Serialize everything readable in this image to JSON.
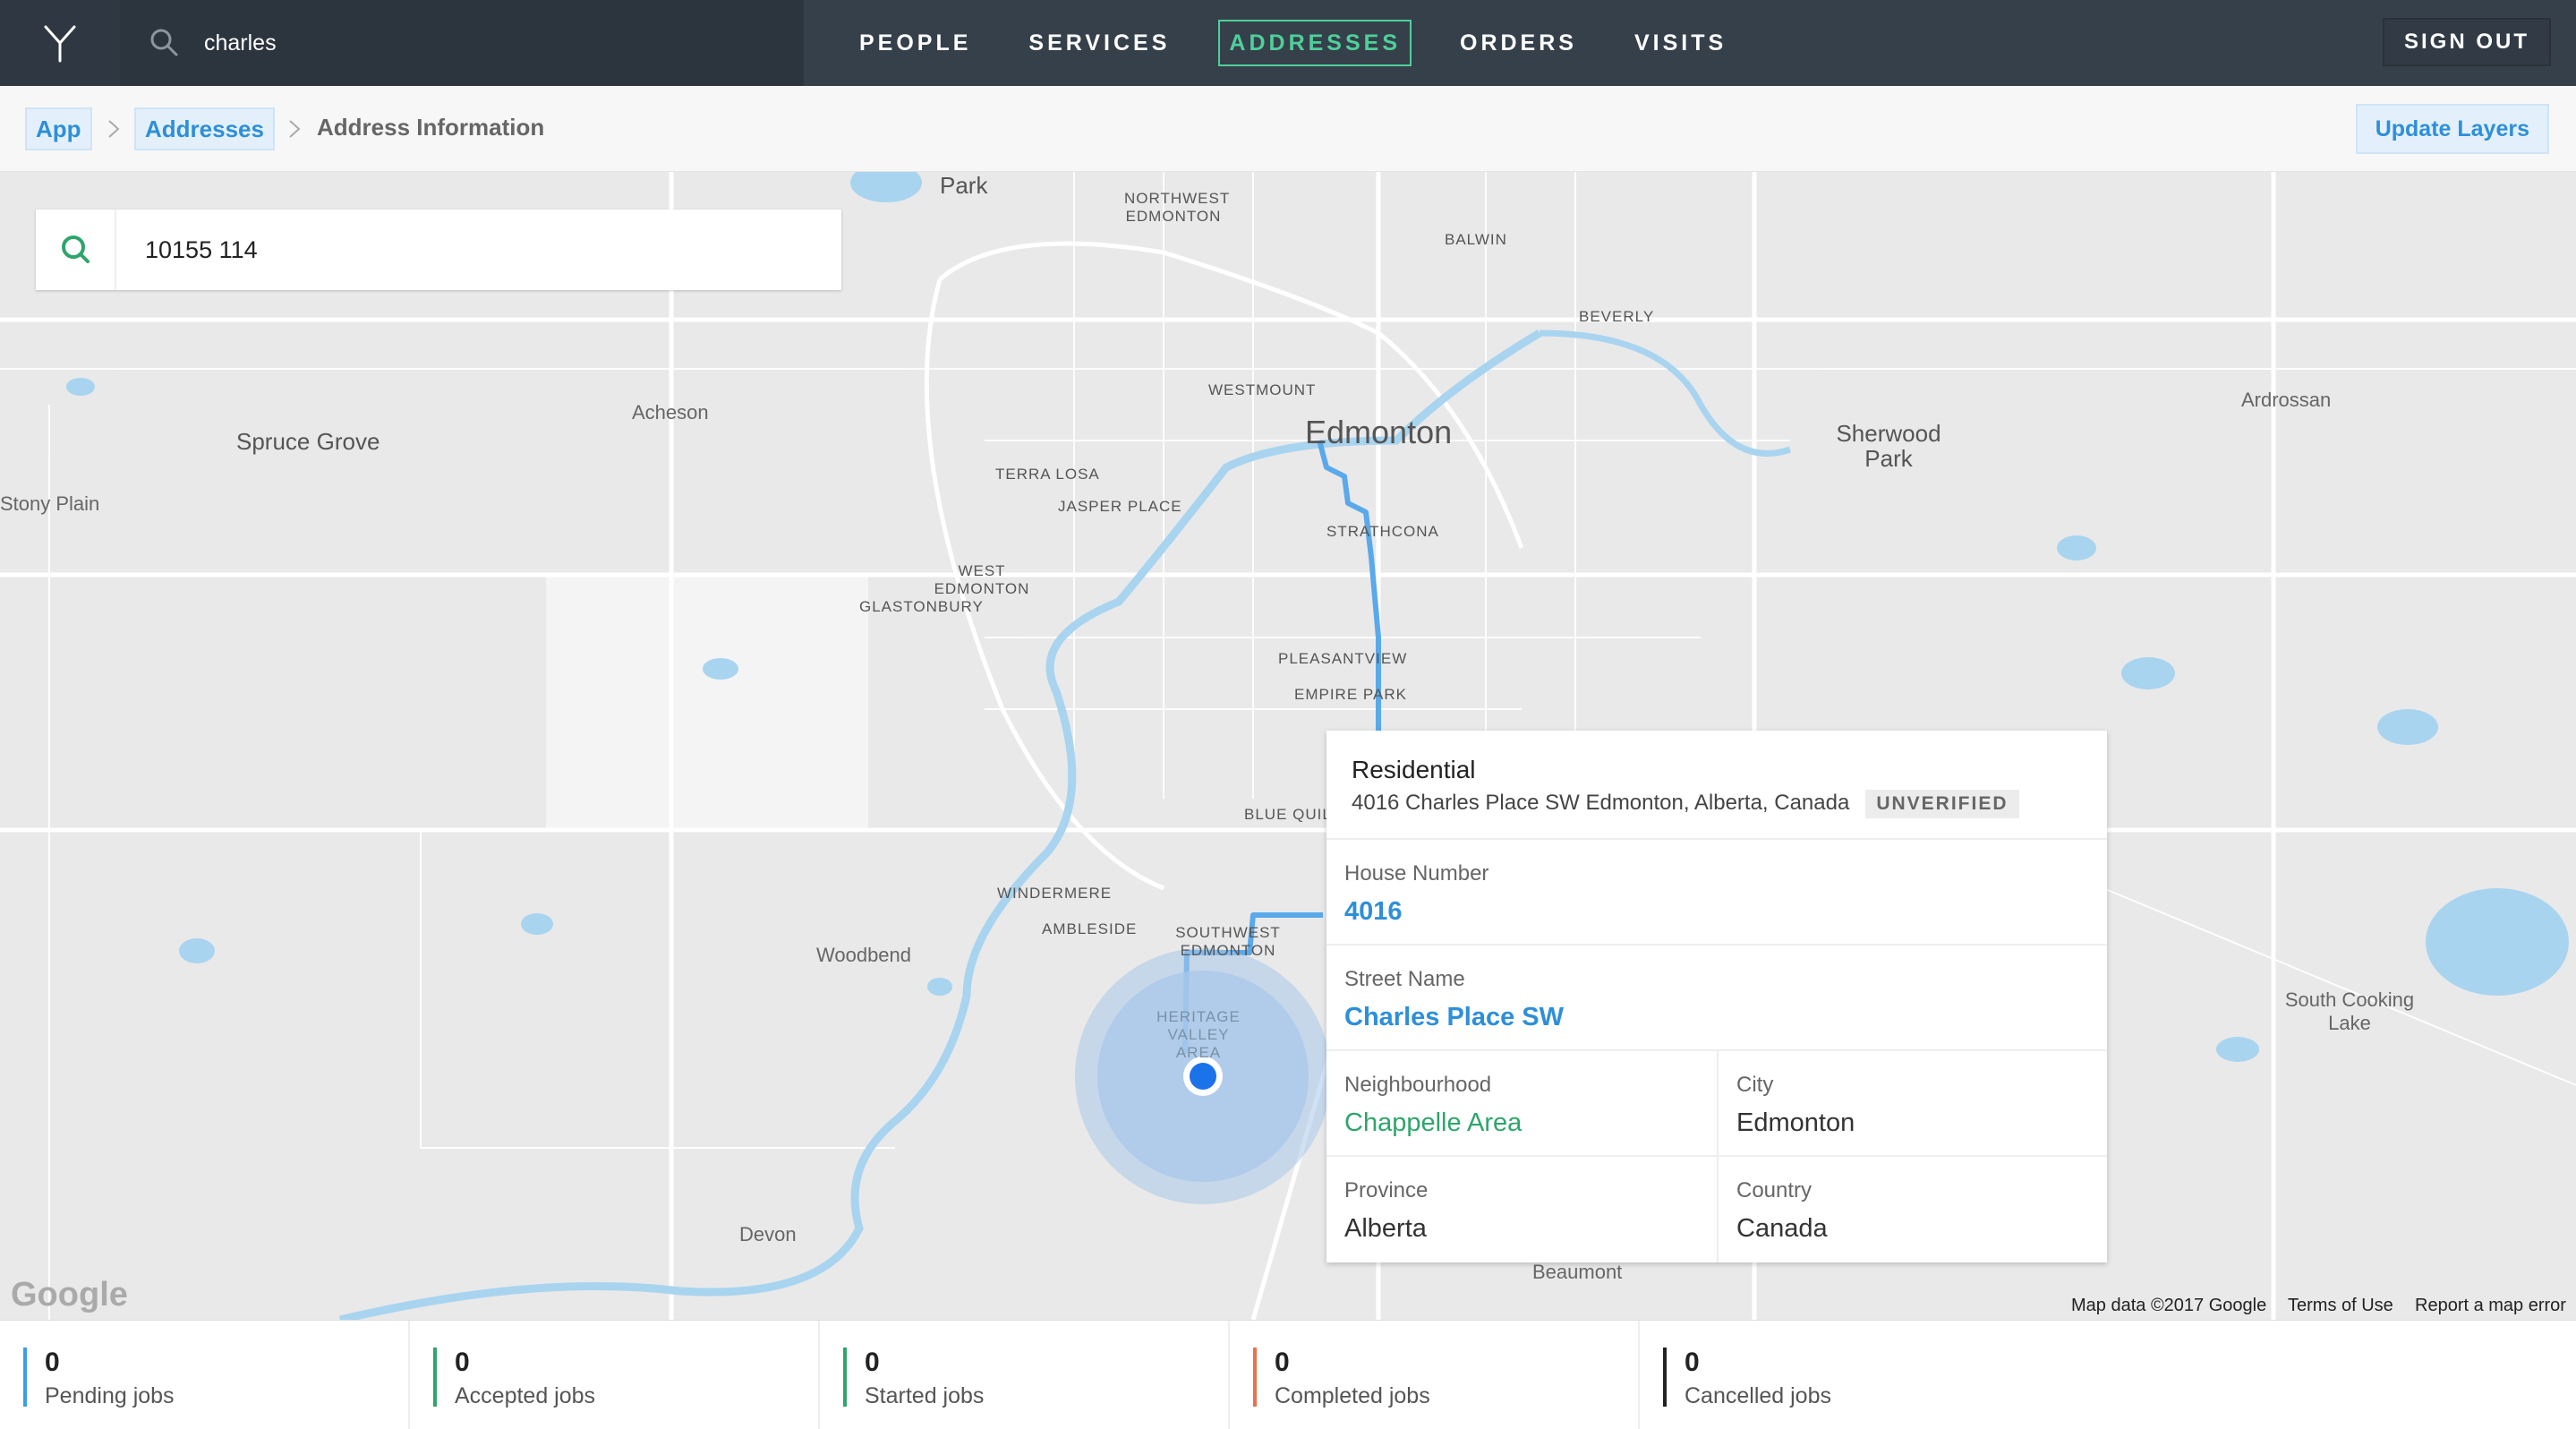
{
  "topbar": {
    "search_value": "charles",
    "nav": [
      "PEOPLE",
      "SERVICES",
      "ADDRESSES",
      "ORDERS",
      "VISITS"
    ],
    "active": "ADDRESSES",
    "sign_out": "SIGN OUT"
  },
  "breadcrumb": {
    "items": [
      "App",
      "Addresses",
      "Address Information"
    ],
    "update_button": "Update Layers"
  },
  "map": {
    "search_value": "10155 114",
    "labels": {
      "park": "Park",
      "northwest_edmonton": "NORTHWEST EDMONTON",
      "balwin": "BALWIN",
      "beverly": "BEVERLY",
      "westmount": "WESTMOUNT",
      "edmonton": "Edmonton",
      "sherwood_park": "Sherwood Park",
      "ardrossan": "Ardrossan",
      "spruce_grove": "Spruce Grove",
      "acheson": "Acheson",
      "stony_plain": "Stony Plain",
      "terra_losa": "TERRA LOSA",
      "jasper_place": "JASPER PLACE",
      "strathcona": "STRATHCONA",
      "west_edmonton": "WEST EDMONTON",
      "glastonbury": "GLASTONBURY",
      "pleasantview": "PLEASANTVIEW",
      "empire_park": "EMPIRE PARK",
      "blue_quill": "BLUE QUILL",
      "windermere": "WINDERMERE",
      "ambleside": "AMBLESIDE",
      "southwest_edmonton": "SOUTHWEST EDMONTON",
      "woodbend": "Woodbend",
      "heritage_valley": "HERITAGE VALLEY AREA",
      "devon": "Devon",
      "beaumont": "Beaumont",
      "south_cooking_lake": "South Cooking Lake"
    },
    "attribution": {
      "google": "Google",
      "map_data": "Map data ©2017 Google",
      "terms": "Terms of Use",
      "report": "Report a map error"
    },
    "colors": {
      "water": "#a8d4f0",
      "route": "#5aa9ea",
      "marker": "#1a73e8"
    }
  },
  "card": {
    "type": "Residential",
    "address": "4016 Charles Place SW Edmonton, Alberta, Canada",
    "badge": "UNVERIFIED",
    "house_number_label": "House Number",
    "house_number": "4016",
    "street_name_label": "Street Name",
    "street_name": "Charles Place SW",
    "neighbourhood_label": "Neighbourhood",
    "neighbourhood": "Chappelle Area",
    "city_label": "City",
    "city": "Edmonton",
    "province_label": "Province",
    "province": "Alberta",
    "country_label": "Country",
    "country": "Canada"
  },
  "stats": [
    {
      "count": "0",
      "label": "Pending jobs",
      "color": "#3a9ee6"
    },
    {
      "count": "0",
      "label": "Accepted jobs",
      "color": "#2ea56b"
    },
    {
      "count": "0",
      "label": "Started jobs",
      "color": "#2ea56b"
    },
    {
      "count": "0",
      "label": "Completed jobs",
      "color": "#e8734a"
    },
    {
      "count": "0",
      "label": "Cancelled jobs",
      "color": "#222222"
    }
  ]
}
